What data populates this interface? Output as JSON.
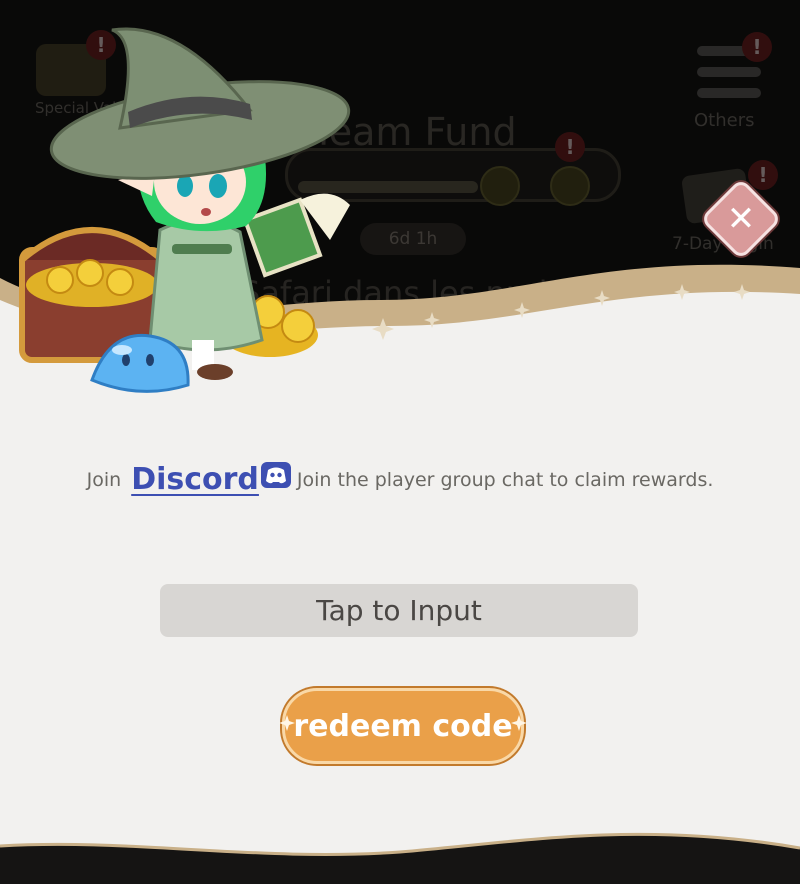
{
  "hud": {
    "top_left_label": "Special Value",
    "fund_title": "Team Fund",
    "timer": "6d 1h",
    "others_label": "Others",
    "login_label": "7-Day Login",
    "banner_text": "Safari dans les prairies",
    "alert_mark": "!"
  },
  "dialog": {
    "intro_prefix": "Join",
    "discord_label": "Discord",
    "intro_suffix": "Join the player group chat to claim rewards.",
    "input_placeholder": "Tap to Input",
    "redeem_label": "redeem code"
  },
  "colors": {
    "panel_bg": "#f2f1ef",
    "panel_border": "#c9b088",
    "discord_blue": "#3d4fb2",
    "button_orange": "#eaa049",
    "input_bg": "#d8d6d3"
  },
  "icons": [
    "close-icon",
    "discord-icon",
    "sparkle-icon",
    "menu-icon",
    "calendar-icon",
    "coin-icon"
  ]
}
